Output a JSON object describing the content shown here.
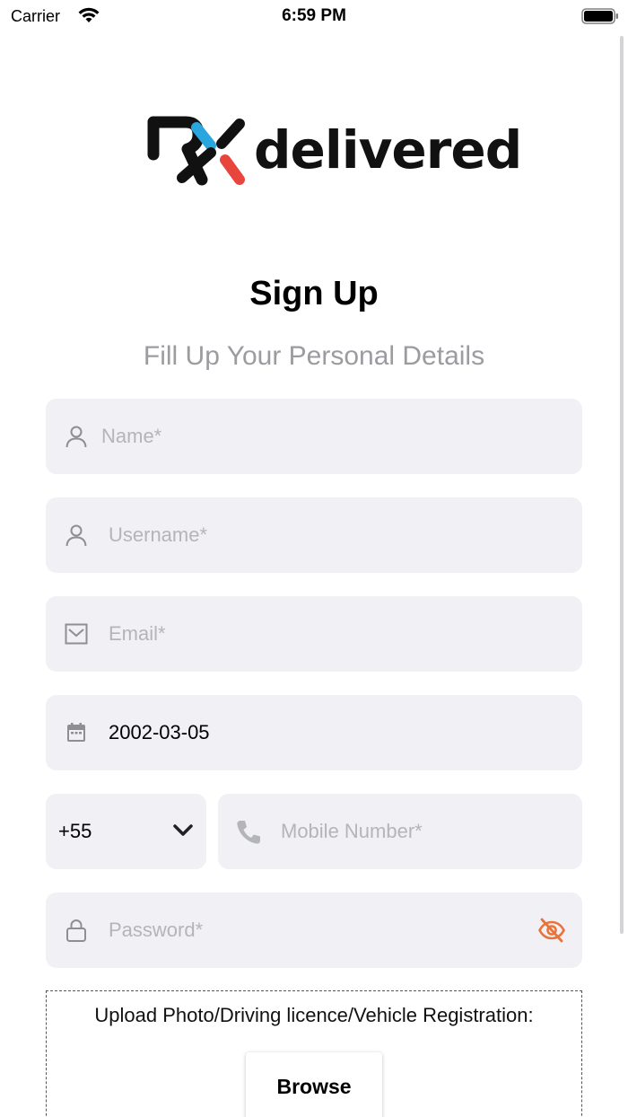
{
  "status_bar": {
    "carrier": "Carrier",
    "time": "6:59 PM"
  },
  "brand": {
    "name": "delivered",
    "mark_colors": [
      "#111111",
      "#2aa6df",
      "#e8453c"
    ]
  },
  "signup": {
    "title": "Sign Up",
    "subtitle": "Fill Up Your Personal Details"
  },
  "form": {
    "name": {
      "placeholder": "Name*",
      "icon": "person-icon"
    },
    "username": {
      "placeholder": "Username*",
      "icon": "person-icon"
    },
    "email": {
      "placeholder": "Email*",
      "icon": "mail-icon"
    },
    "dob": {
      "value": "2002-03-05",
      "icon": "calendar-icon"
    },
    "country_code": {
      "value": "+55",
      "icon": "chevron-down-icon"
    },
    "mobile": {
      "placeholder": "Mobile Number*",
      "icon": "phone-icon"
    },
    "password": {
      "placeholder": "Password*",
      "icon": "lock-icon",
      "toggle_icon": "eye-off-icon",
      "toggle_color": "#e8743c"
    }
  },
  "upload": {
    "label": "Upload Photo/Driving licence/Vehicle Registration:",
    "browse_label": "Browse"
  },
  "colors": {
    "field_bg": "#f0f0f5",
    "placeholder": "#b4b4bb",
    "subtitle": "#9b9ba0"
  }
}
